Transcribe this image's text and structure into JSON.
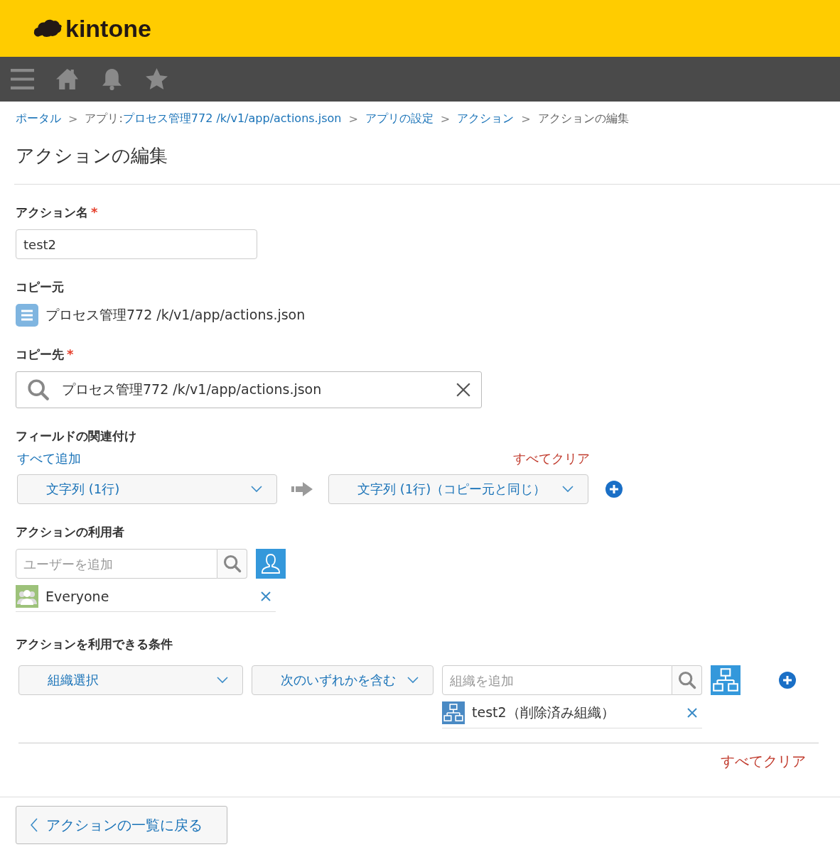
{
  "header": {
    "logo": "kintone"
  },
  "breadcrumb": [
    {
      "label": "ポータル",
      "link": true
    },
    {
      "separator": ">",
      "prefix": "アプリ: ",
      "label": "プロセス管理772 /k/v1/app/actions.json",
      "link": true
    },
    {
      "separator": ">",
      "label": "アプリの設定",
      "link": true
    },
    {
      "separator": ">",
      "label": "アクション",
      "link": true
    },
    {
      "separator": ">",
      "label": "アクションの編集",
      "link": false
    }
  ],
  "page_title": "アクションの編集",
  "action_name": {
    "label": "アクション名",
    "required_mark": "*",
    "value": "test2"
  },
  "copy_from": {
    "label": "コピー元",
    "app": "プロセス管理772 /k/v1/app/actions.json"
  },
  "copy_to": {
    "label": "コピー先",
    "required_mark": "*",
    "value": "プロセス管理772 /k/v1/app/actions.json"
  },
  "field_mapping": {
    "label": "フィールドの関連付け",
    "add_all": "すべて追加",
    "clear_all": "すべてクリア",
    "rows": [
      {
        "source": "文字列 (1行)",
        "target": "文字列 (1行)（コピー元と同じ）"
      }
    ]
  },
  "users": {
    "label": "アクションの利用者",
    "placeholder": "ユーザーを追加",
    "entities": [
      {
        "name": "Everyone",
        "kind": "group"
      }
    ]
  },
  "conditions": {
    "label": "アクションを利用できる条件",
    "clear_all": "すべてクリア",
    "rows": [
      {
        "type": "組織選択",
        "operator": "次のいずれかを含む",
        "placeholder": "組織を追加",
        "entities": [
          {
            "name": "test2（削除済み組織）",
            "kind": "org"
          }
        ]
      }
    ]
  },
  "back_button": "アクションの一覧に戻る"
}
